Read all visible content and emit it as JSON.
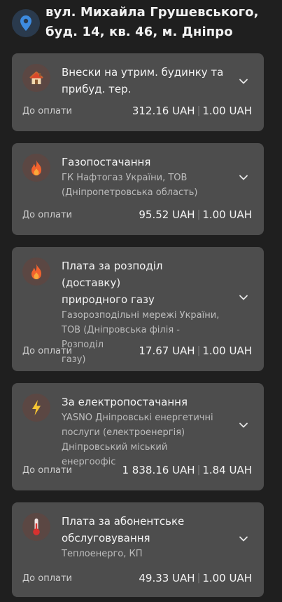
{
  "address": {
    "line1": "вул. Михайла Грушевського,",
    "line2": "буд. 14, кв. 46, м. Дніпро"
  },
  "cards": [
    {
      "icon": "house-icon",
      "title_lines": [
        "Внески на утрим. будинку та",
        "прибуд. тер."
      ],
      "sub_lines": [],
      "due_label": "До оплати",
      "amount": "312.16 UAH",
      "fee": "1.00 UAH"
    },
    {
      "icon": "flame-icon",
      "title_lines": [
        "Газопостачання"
      ],
      "sub_lines": [
        "ГК Нафтогаз України, ТОВ",
        "(Дніпропетровська область)"
      ],
      "due_label": "До оплати",
      "amount": "95.52 UAH",
      "fee": "1.00 UAH"
    },
    {
      "icon": "flame-icon",
      "title_lines": [
        "Плата за розподіл (доставку)",
        "природного газу"
      ],
      "sub_lines": [
        "Газорозподільні мережі України,",
        "ТОВ (Дніпровська філія - Розподіл",
        "газу)"
      ],
      "due_label": "До оплати",
      "amount": "17.67 UAH",
      "fee": "1.00 UAH"
    },
    {
      "icon": "lightning-icon",
      "title_lines": [
        "За електропостачання"
      ],
      "sub_lines": [
        "YASNO Дніпровські енергетичні",
        "послуги (електроенергія)",
        "Дніпровський міський енергоофіс"
      ],
      "due_label": "До оплати",
      "amount": "1 838.16 UAH",
      "fee": "1.84 UAH"
    },
    {
      "icon": "thermometer-icon",
      "title_lines": [
        "Плата за абонентське",
        "обслуговування"
      ],
      "sub_lines": [
        "Теплоенерго, КП"
      ],
      "due_label": "До оплати",
      "amount": "49.33 UAH",
      "fee": "1.00 UAH"
    }
  ],
  "colors": {
    "background": "#1f1f1f",
    "card": "#4d4d4d",
    "pin": "#3d8be0",
    "flame": "#f2622e",
    "lightning": "#f6c533",
    "thermometer": "#d8312f"
  }
}
